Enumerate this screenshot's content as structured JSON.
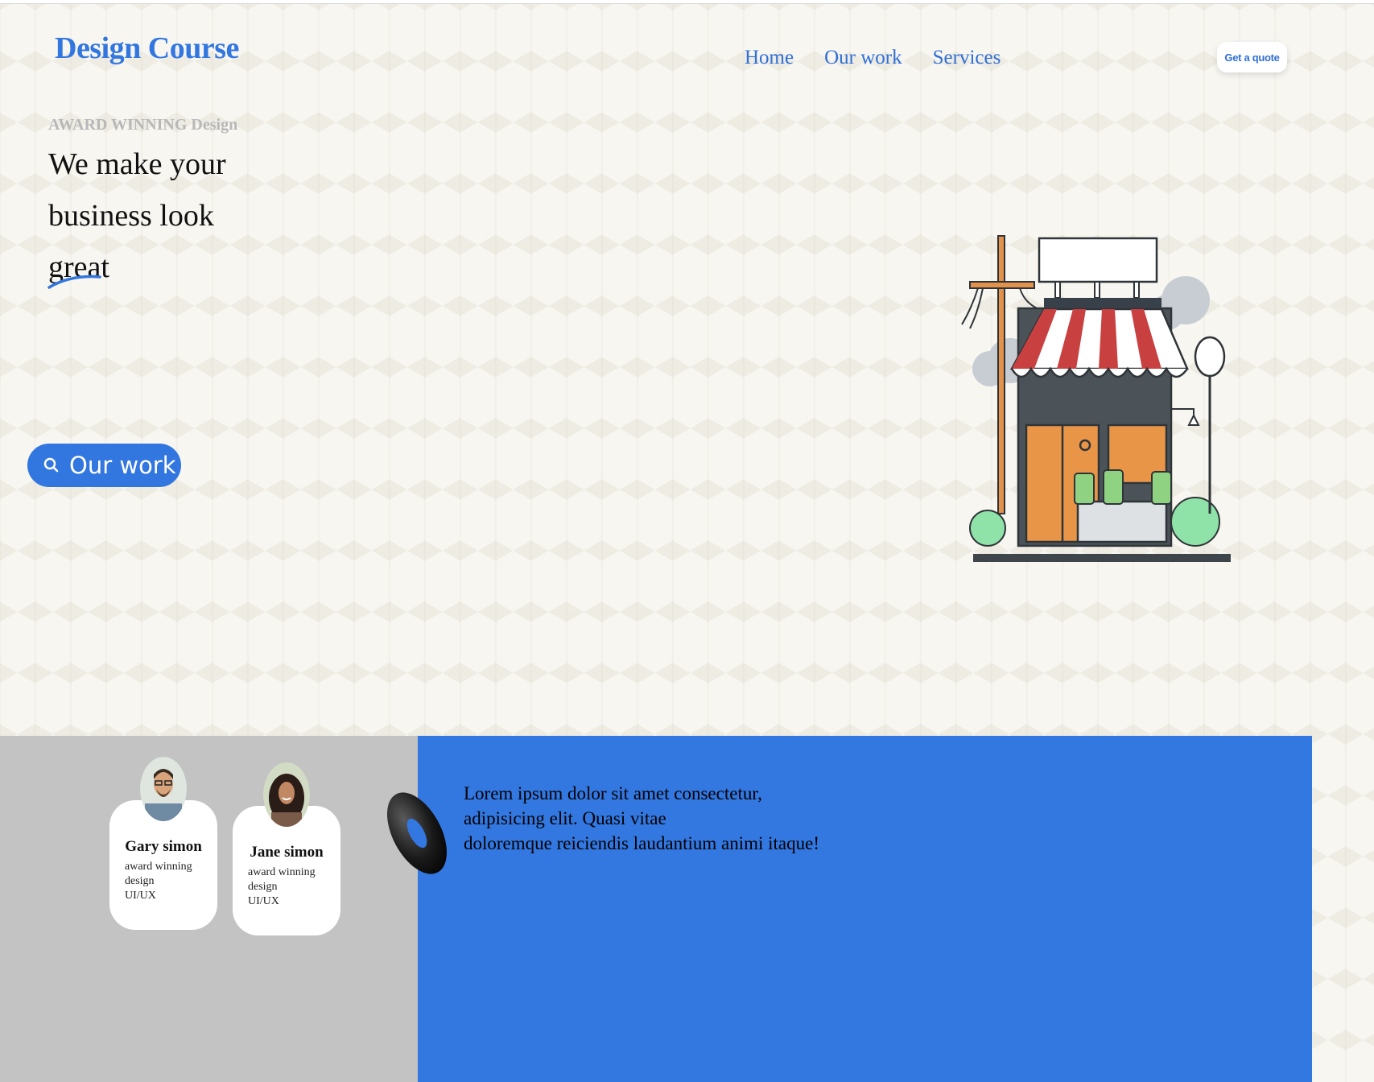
{
  "header": {
    "logo": "Design Course",
    "nav": [
      "Home",
      "Our work",
      "Services"
    ],
    "quote_label": "Get a quote"
  },
  "hero": {
    "eyebrow": "AWARD WINNING Design",
    "headline": [
      "We make your",
      "business look",
      "great"
    ],
    "cta_label": "Our work",
    "cta_icon": "search-icon",
    "illustration": "storefront-illustration"
  },
  "team": [
    {
      "name": "Gary simon",
      "role_line1": "award winning design",
      "role_line2": "UI/UX"
    },
    {
      "name": "Jane simon",
      "role_line1": "award winning design",
      "role_line2": "UI/UX"
    }
  ],
  "about": {
    "text_lines": [
      "Lorem ipsum dolor sit amet consectetur,",
      "adipisicing elit. Quasi vitae",
      "doloremque reiciendis laudantium animi itaque!"
    ]
  },
  "colors": {
    "accent": "#3276e0",
    "blue_panel": "#3377e0",
    "gray_panel": "#c3c3c3"
  }
}
